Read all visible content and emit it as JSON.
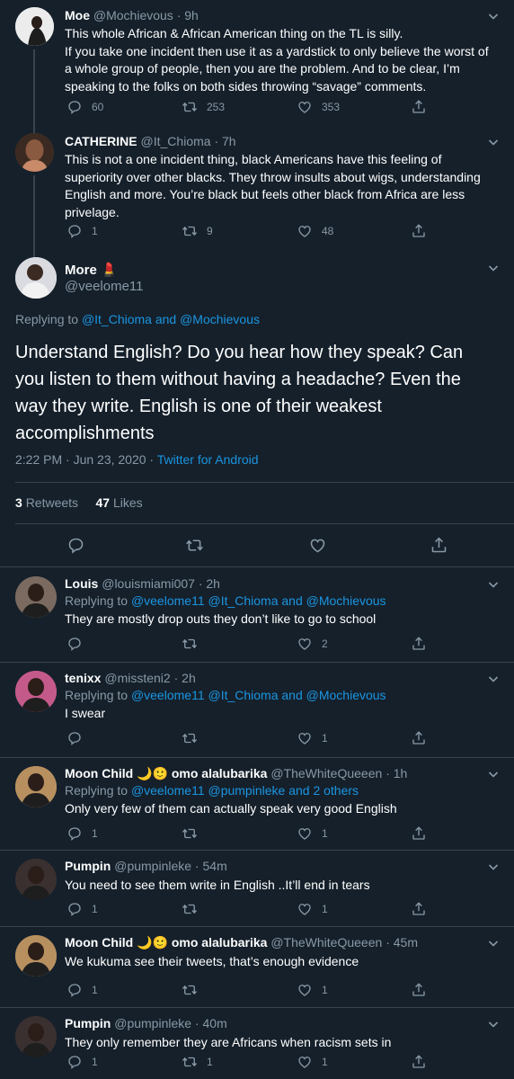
{
  "colors": {
    "background": "#15202b",
    "muted": "#8899a6",
    "link": "#1b95e0",
    "separator": "#38444d"
  },
  "tweets_above": [
    {
      "name": "Moe",
      "handle": "@Mochievous",
      "time": "9h",
      "lines": [
        "This whole African & African American thing on the TL is silly.",
        "If you take one incident then use it as a yardstick to only believe the worst of",
        "a whole group of people, then you are the problem. And to be clear, I’m",
        "speaking to the folks on both sides throwing “savage” comments."
      ],
      "replies": "60",
      "retweets": "253",
      "likes": "353"
    },
    {
      "name": "CATHERINE",
      "handle": "@It_Chioma",
      "time": "7h",
      "lines": [
        "This is not a one incident thing, black Americans have this feeling of",
        "superiority over other blacks. They throw insults about wigs, understanding",
        "English and more. You’re black but feels other black from Africa are less",
        "privelage."
      ],
      "replies": "1",
      "retweets": "9",
      "likes": "48"
    }
  ],
  "main_tweet": {
    "name": "More",
    "emoji": "💄",
    "handle": "@veelome11",
    "replying_prefix": "Replying to",
    "replying_users": "@It_Chioma and @Mochievous",
    "lines": [
      "Understand English? Do you hear how they speak? Can",
      "you listen to them without having a headache? Even the",
      "way they write. English is one of their weakest",
      "accomplishments"
    ],
    "timestamp": "2:22 PM · Jun 23, 2020 ·",
    "client": "Twitter for Android",
    "retweet_count": "3",
    "retweet_label": "Retweets",
    "like_count": "47",
    "like_label": "Likes"
  },
  "replies": [
    {
      "name": "Louis",
      "emoji": "",
      "name2": "",
      "handle": "@louismiami007",
      "time": "2h",
      "replying_prefix": "Replying to",
      "replying_users": "@veelome11 @It_Chioma and @Mochievous",
      "text": "They are mostly drop outs they don’t like to go to school",
      "replies": "",
      "retweets": "",
      "likes": "2"
    },
    {
      "name": "tenixx",
      "emoji": "",
      "name2": "",
      "handle": "@missteni2",
      "time": "2h",
      "replying_prefix": "Replying to",
      "replying_users": "@veelome11 @It_Chioma and @Mochievous",
      "text": "I swear",
      "replies": "",
      "retweets": "",
      "likes": "1"
    },
    {
      "name": "Moon Child",
      "emoji": "🌙🙂",
      "name2": "omo alalubarika",
      "handle": "@TheWhiteQueeen",
      "time": "1h",
      "replying_prefix": "Replying to",
      "replying_users": "@veelome11 @pumpinleke and 2 others",
      "text": "Only very few of them can actually speak very good English",
      "replies": "1",
      "retweets": "",
      "likes": "1"
    },
    {
      "name": "Pumpin",
      "emoji": "",
      "name2": "",
      "handle": "@pumpinleke",
      "time": "54m",
      "replying_prefix": "",
      "replying_users": "",
      "text": "You need to see them write in English ..It’ll end in tears",
      "replies": "1",
      "retweets": "",
      "likes": "1"
    },
    {
      "name": "Moon Child",
      "emoji": "🌙🙂",
      "name2": "omo alalubarika",
      "handle": "@TheWhiteQueeen",
      "time": "45m",
      "replying_prefix": "",
      "replying_users": "",
      "text": "We kukuma see their tweets, that’s enough evidence",
      "replies": "1",
      "retweets": "",
      "likes": "1"
    },
    {
      "name": "Pumpin",
      "emoji": "",
      "name2": "",
      "handle": "@pumpinleke",
      "time": "40m",
      "replying_prefix": "",
      "replying_users": "",
      "text": "They only remember they are Africans when racism sets in",
      "replies": "1",
      "retweets": "1",
      "likes": "1"
    }
  ],
  "icons": {
    "reply": "reply-icon",
    "retweet": "retweet-icon",
    "like": "heart-icon",
    "share": "share-icon",
    "menu": "chevron-down-icon"
  }
}
